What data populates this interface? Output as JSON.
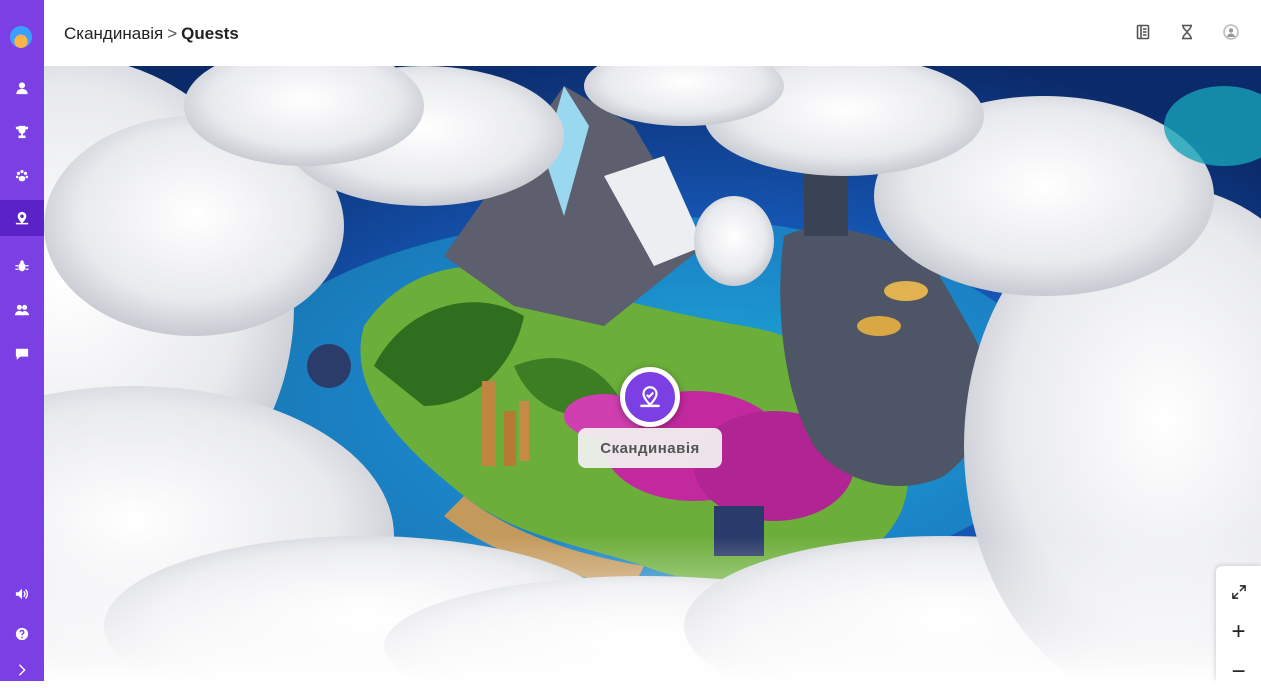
{
  "header": {
    "breadcrumb_parent": "Скандинавія",
    "breadcrumb_separator": ">",
    "breadcrumb_current": "Quests"
  },
  "sidebar": {
    "items": [
      {
        "icon": "user-icon",
        "active": false
      },
      {
        "icon": "trophy-icon",
        "active": false
      },
      {
        "icon": "paw-icon",
        "active": false
      },
      {
        "icon": "map-marker-icon",
        "active": true
      },
      {
        "icon": "bug-icon",
        "active": false
      },
      {
        "icon": "group-icon",
        "active": false
      },
      {
        "icon": "chat-icon",
        "active": false
      },
      {
        "icon": "sound-icon",
        "active": false
      },
      {
        "icon": "help-icon",
        "active": false
      },
      {
        "icon": "expand-icon",
        "active": false
      }
    ],
    "accent_color": "#7b3fe4"
  },
  "header_icons": [
    "book-icon",
    "hourglass-icon",
    "avatar-icon"
  ],
  "map": {
    "location_label": "Скандинавія"
  },
  "zoom_controls": {
    "fullscreen_icon": "fullscreen-icon",
    "zoom_in": "+",
    "zoom_out": "−"
  }
}
